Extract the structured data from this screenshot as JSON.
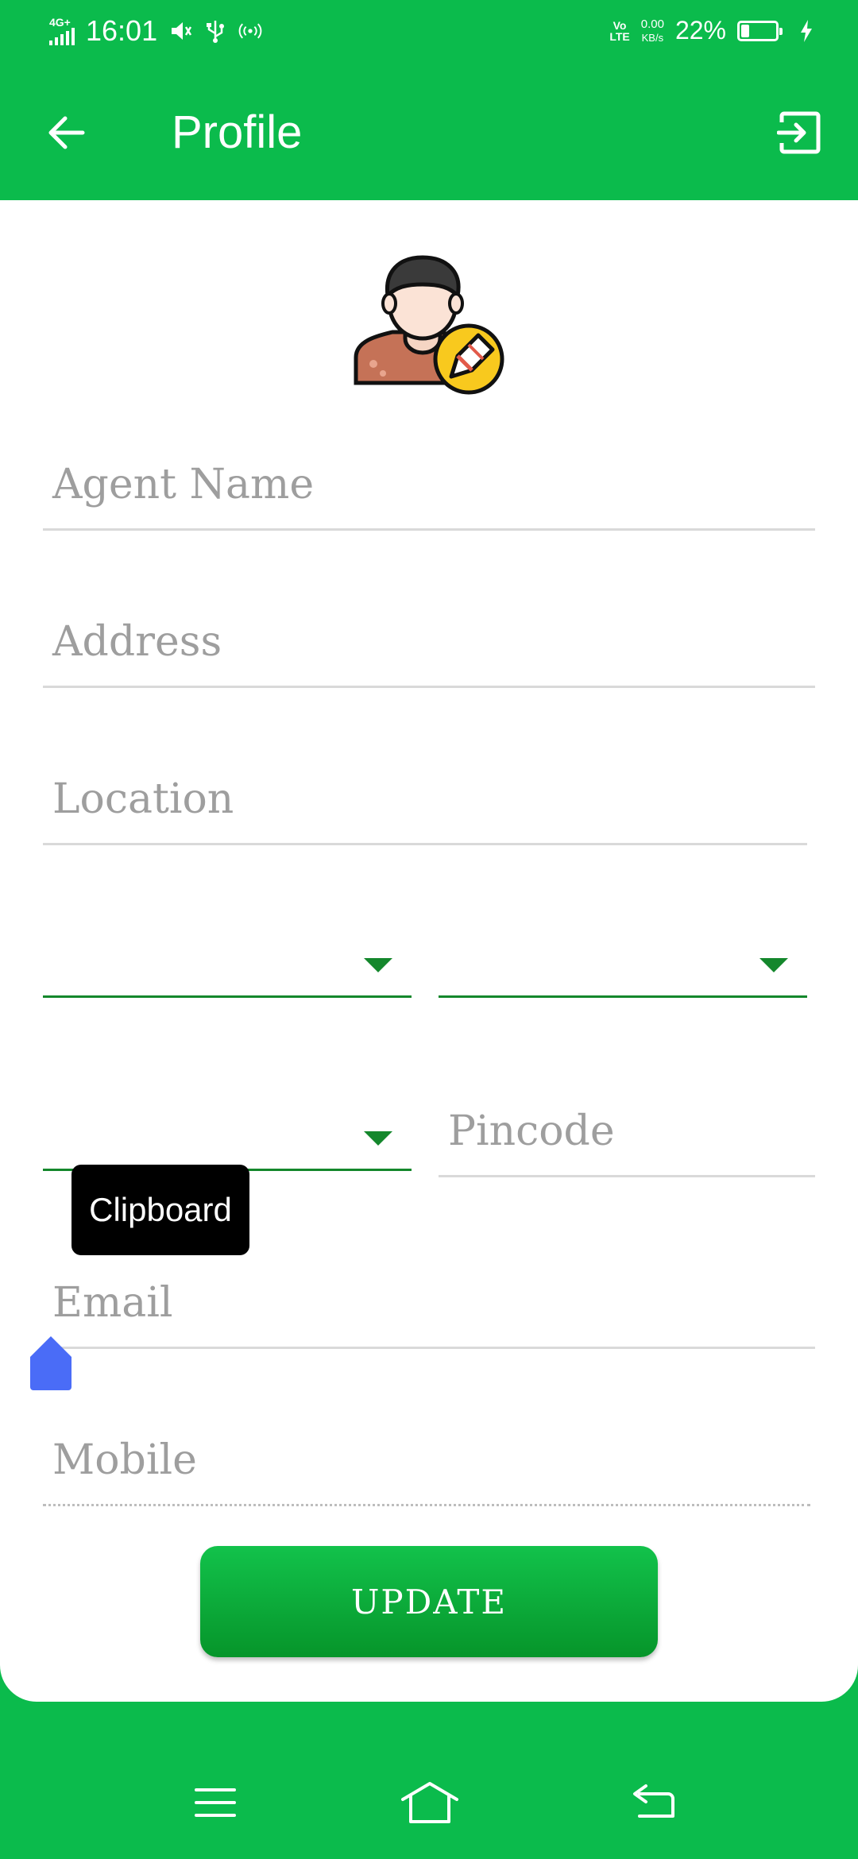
{
  "status_bar": {
    "network": "4G+",
    "time": "16:01",
    "volte": "VoLTE",
    "volte_line1": "Vo",
    "volte_line2": "LTE",
    "speed_value": "0.00",
    "speed_unit": "KB/s",
    "battery_percent": "22%",
    "battery_level": 0.22,
    "icons": [
      "signal-icon",
      "mute-icon",
      "usb-icon",
      "hotspot-icon",
      "battery-icon",
      "charging-icon"
    ]
  },
  "app_bar": {
    "title": "Profile",
    "back_icon": "arrow-left-icon",
    "logout_icon": "logout-icon",
    "color": "#0bbb4c"
  },
  "form": {
    "agent_name_placeholder": "Agent Name",
    "address_placeholder": "Address",
    "location_placeholder": "Location",
    "dropdown_1_value": "",
    "dropdown_2_value": "",
    "dropdown_3_value": "",
    "pincode_placeholder": "Pincode",
    "email_placeholder": "Email",
    "mobile_placeholder": "Mobile",
    "accent_color": "#14872c"
  },
  "clipboard_tooltip": "Clipboard",
  "update_button": "UPDATE",
  "nav_bar": {
    "icons": [
      "menu-icon",
      "home-icon",
      "back-icon"
    ]
  }
}
